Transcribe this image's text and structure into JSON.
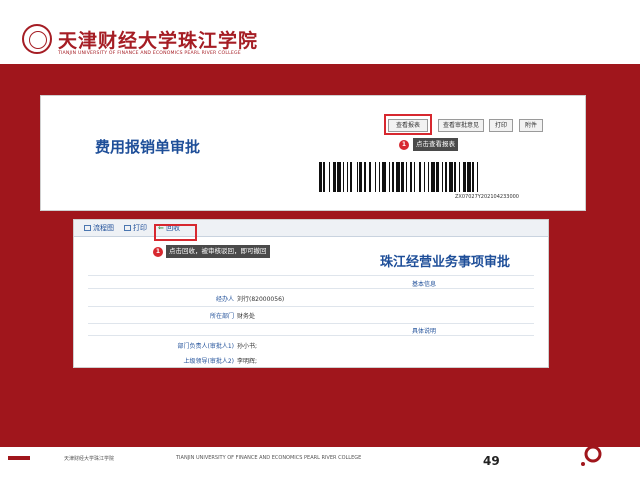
{
  "header": {
    "logo_cn": "天津财经大学珠江学院",
    "logo_en": "TIANJIN UNIVERSITY OF FINANCE AND ECONOMICS PEARL RIVER COLLEGE"
  },
  "shot1": {
    "title": "费用报销单审批",
    "buttons": [
      {
        "label": "查看报表"
      },
      {
        "label": "查看审批意见"
      },
      {
        "label": "打印"
      },
      {
        "label": "附件"
      }
    ],
    "callout_number": "1",
    "tooltip": "点击查看报表",
    "barcode_number": "ZX07027Y202104233000"
  },
  "shot2": {
    "toolbar": [
      {
        "label": "流程图"
      },
      {
        "label": "打印"
      },
      {
        "label": "回收"
      }
    ],
    "callout_number": "1",
    "tooltip": "点击回收，被审核驳回，即可撤回",
    "title": "珠江经营业务事项审批",
    "section_basic": "基本信息",
    "section_detail": "具体说明",
    "fields": [
      {
        "label": "经办人",
        "value": "刘行(82000056)"
      },
      {
        "label": "所在部门",
        "value": "财务处"
      },
      {
        "label": "部门负责人(审批人1)",
        "value": "孙小书;"
      },
      {
        "label": "上级领导(审批人2)",
        "value": "李明辉;"
      }
    ]
  },
  "footer": {
    "cn": "天津财经大学珠江学院",
    "en": "TIANJIN UNIVERSITY OF FINANCE AND ECONOMICS PEARL RIVER COLLEGE",
    "page_number": "49"
  },
  "colors": {
    "brand_red": "#a0161c",
    "highlight_red": "#d7282f",
    "title_blue": "#1f4f99"
  }
}
